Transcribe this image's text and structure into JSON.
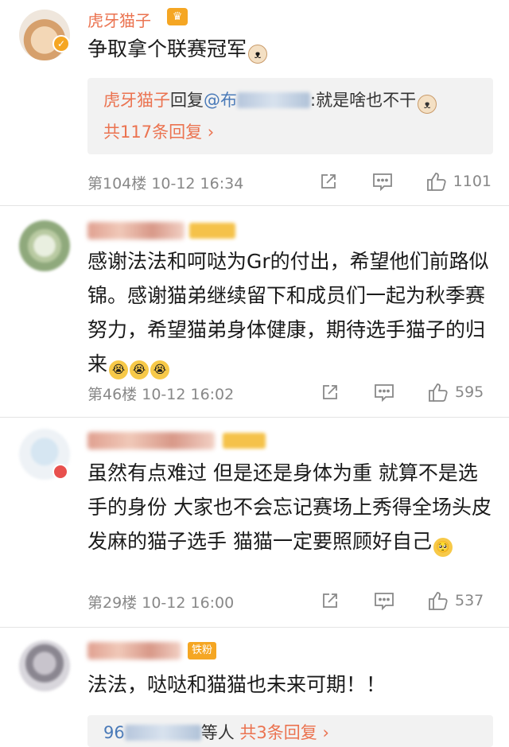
{
  "comments": [
    {
      "user": "虎牙猫子",
      "text": "争取拿个联赛冠军",
      "reply_preview": {
        "author": "虎牙猫子",
        "verb": "回复",
        "mention": "@布",
        "content": ":就是啥也不干",
        "more": "共117条回复 ›"
      },
      "floor": "第104楼",
      "time": "10-12 16:34",
      "likes": "1101"
    },
    {
      "badge_icon": "fan-badge",
      "text": "感谢法法和呵哒为Gr的付出，希望他们前路似锦。感谢猫弟继续留下和成员们一起为秋季赛努力，希望猫弟身体健康，期待选手猫子的归来",
      "floor": "第46楼",
      "time": "10-12 16:02",
      "likes": "595"
    },
    {
      "text": "虽然有点难过 但是还是身体为重 就算不是选手的身份 大家也不会忘记赛场上秀得全场头皮发麻的猫子选手 猫猫一定要照顾好自己",
      "floor": "第29楼",
      "time": "10-12 16:00",
      "likes": "537"
    },
    {
      "badge": "铁粉",
      "text": "法法，哒哒和猫猫也未来可期！！",
      "reply_preview": {
        "author_prefix": "96",
        "suffix": "等人",
        "more": "共3条回复 ›"
      }
    }
  ],
  "colors": {
    "username": "#eb7350",
    "link": "#eb7350",
    "meta": "#888888",
    "reply_bg": "#f2f2f2",
    "badge": "#f5a623"
  },
  "icons": [
    "crown-icon",
    "verified-icon",
    "share-icon",
    "comment-icon",
    "like-icon",
    "emoji-icon"
  ]
}
